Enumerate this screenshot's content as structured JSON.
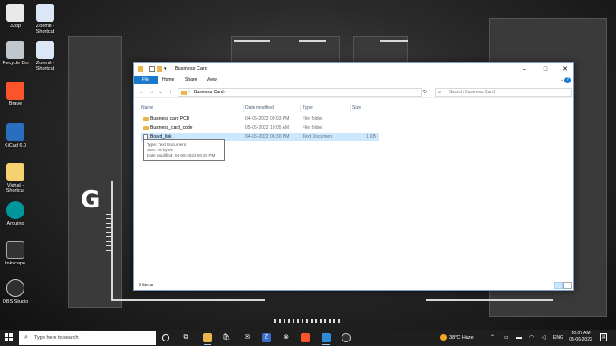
{
  "desktop": {
    "icons": [
      {
        "label": "328p",
        "icon": "app-icon",
        "color": "#ffffff"
      },
      {
        "label": "Recycle Bin",
        "icon": "recycle-bin-icon",
        "color": "#bfc7cf"
      },
      {
        "label": "Brave",
        "icon": "brave-icon",
        "color": "#fb542b"
      },
      {
        "label": "KiCad 6.0",
        "icon": "kicad-icon",
        "color": "#2a6ebf"
      },
      {
        "label": "Vishal - Shortcut",
        "icon": "text-file-icon",
        "color": "#f3d26f"
      },
      {
        "label": "Arduino",
        "icon": "arduino-icon",
        "color": "#00979c"
      },
      {
        "label": "Inkscape",
        "icon": "inkscape-icon",
        "color": "#333333"
      },
      {
        "label": "OBS Studio",
        "icon": "obs-icon",
        "color": "#302e31"
      },
      {
        "label": "Zoomit - Shortcut",
        "icon": "zoomit-icon",
        "color": "#dbe7f5"
      },
      {
        "label": "Zoomit - Shortcut",
        "icon": "zoomit-icon",
        "color": "#dbe7f5"
      }
    ]
  },
  "explorer": {
    "title": "Business Card",
    "ribbon_tabs": [
      "File",
      "Home",
      "Share",
      "View"
    ],
    "address_crumb": "Business Card",
    "search_placeholder": "Search Business Card",
    "columns": [
      "Name",
      "Date modified",
      "Type",
      "Size"
    ],
    "rows": [
      {
        "name": "Business card PCB",
        "date": "04-06-2022 09:03 PM",
        "type": "File folder",
        "size": "",
        "icon": "folder-icon"
      },
      {
        "name": "Business_card_code",
        "date": "05-06-2022 10:05 AM",
        "type": "File folder",
        "size": "",
        "icon": "folder-icon"
      },
      {
        "name": "Board_link",
        "date": "04-06-2022 06:30 PM",
        "type": "Text Document",
        "size": "1 KB",
        "icon": "text-document-icon"
      }
    ],
    "tooltip": {
      "type": "Type: Text Document",
      "size": "Size: 49 bytes",
      "modified": "Date modified: 04-06-2022 06:30 PM"
    },
    "status": "3 items",
    "accent": "#1979ca"
  },
  "taskbar": {
    "search_placeholder": "Type here to search",
    "weather": "38°C  Haze",
    "language": "ENG",
    "time": "10:07 AM",
    "date": "05-06-2022"
  }
}
